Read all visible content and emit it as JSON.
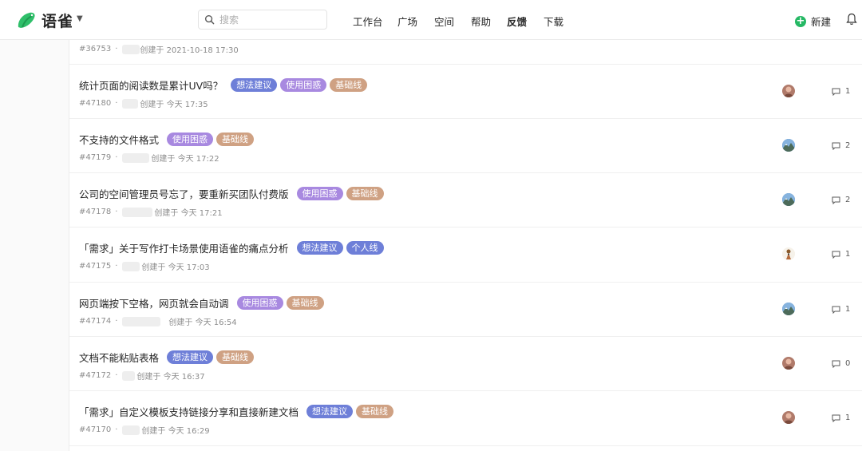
{
  "app": {
    "name": "语雀"
  },
  "search": {
    "placeholder": "搜索"
  },
  "nav": [
    "工作台",
    "广场",
    "空间",
    "帮助",
    "反馈",
    "下载"
  ],
  "header": {
    "new_label": "新建"
  },
  "colors": {
    "brand": "#25b864",
    "tag_idea": "#6e7fd8",
    "tag_confuse": "#a889e0",
    "tag_base": "#cfa183"
  },
  "partial_row": {
    "id": "#36753",
    "created": "创建于 2021-10-18 17:30"
  },
  "issues": [
    {
      "title": "统计页面的阅读数是累计UV吗？",
      "tags": [
        "想法建议",
        "使用困惑",
        "基础线"
      ],
      "id": "#47180",
      "created": "创建于 今天 17:35",
      "comments": "1",
      "avatar": "avatar-brown"
    },
    {
      "title": "不支持的文件格式",
      "tags": [
        "使用困惑",
        "基础线"
      ],
      "id": "#47179",
      "created": "创建于 今天 17:22",
      "comments": "2",
      "avatar": "avatar-mountain"
    },
    {
      "title": "公司的空间管理员号忘了，要重新买团队付费版",
      "tags": [
        "使用困惑",
        "基础线"
      ],
      "id": "#47178",
      "created": "创建于 今天 17:21",
      "comments": "2",
      "avatar": "avatar-mountain"
    },
    {
      "title": "「需求」关于写作打卡场景使用语雀的痛点分析",
      "tags": [
        "想法建议",
        "个人线"
      ],
      "id": "#47175",
      "created": "创建于 今天 17:03",
      "comments": "1",
      "avatar": "avatar-figure"
    },
    {
      "title": "网页端按下空格，网页就会自动调",
      "tags": [
        "使用困惑",
        "基础线"
      ],
      "id": "#47174",
      "created": "创建于 今天 16:54",
      "comments": "1",
      "avatar": "avatar-mountain"
    },
    {
      "title": "文档不能粘贴表格",
      "tags": [
        "想法建议",
        "基础线"
      ],
      "id": "#47172",
      "created": "创建于 今天 16:37",
      "comments": "0",
      "avatar": "avatar-brown"
    },
    {
      "title": "「需求」自定义模板支持链接分享和直接新建文档",
      "tags": [
        "想法建议",
        "基础线"
      ],
      "id": "#47170",
      "created": "创建于 今天 16:29",
      "comments": "1",
      "avatar": "avatar-brown"
    }
  ]
}
